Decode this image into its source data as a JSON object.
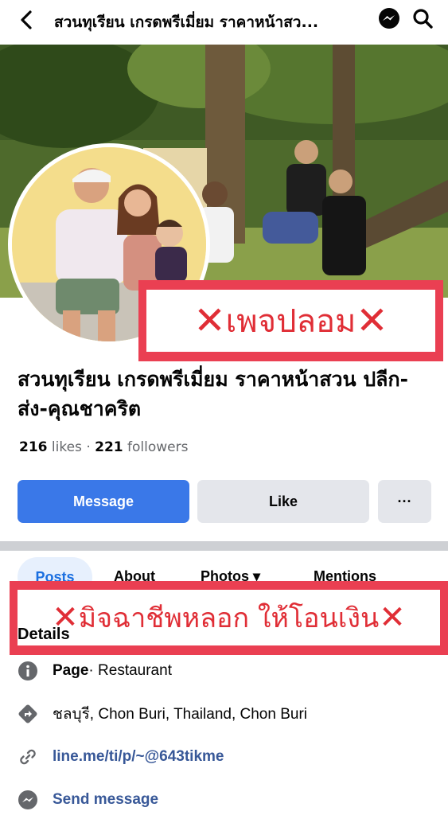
{
  "header": {
    "title": "สวนทุเรียน เกรดพรีเมี่ยม ราคาหน้าสว...",
    "back_icon": "back-arrow-icon",
    "messenger_icon": "messenger-icon",
    "search_icon": "search-icon"
  },
  "overlays": {
    "fake_page": "เพจปลอม",
    "scam_warning": "มิจฉาชีพหลอก ให้โอนเงิน",
    "x_mark": "✕",
    "badge_color": "#ea3f52",
    "text_color": "#e02e36"
  },
  "page": {
    "name": "สวนทุเรียน เกรดพรีเมี่ยม ราคาหน้าสวน ปลีก-ส่ง-คุณชาคริต",
    "likes_count": "216",
    "likes_label": "likes",
    "separator": "·",
    "followers_count": "221",
    "followers_label": "followers"
  },
  "actions": {
    "message": "Message",
    "like": "Like",
    "more": "···",
    "primary_color": "#3a78e8"
  },
  "tabs": [
    "Posts",
    "About",
    "Photos ▾",
    "Mentions"
  ],
  "details": {
    "title": "Details",
    "category_bold": "Page",
    "category_rest": " · Restaurant",
    "location": "ชลบุรี, Chon Buri, Thailand, Chon Buri",
    "link": "line.me/ti/p/~@643tikme",
    "send_message": "Send message"
  }
}
